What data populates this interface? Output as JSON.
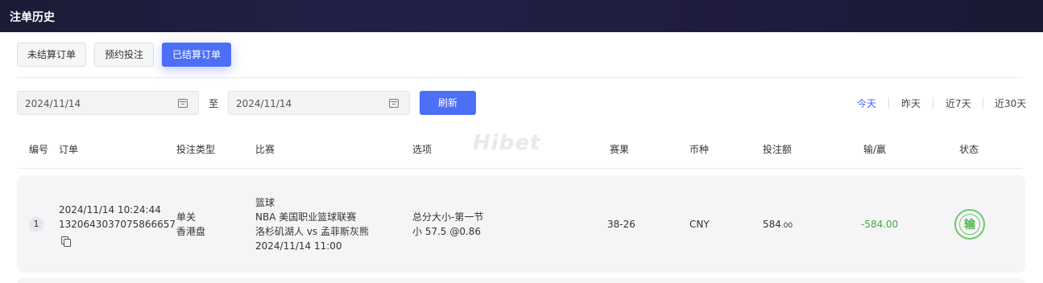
{
  "header": {
    "title": "注单历史"
  },
  "tabs": [
    {
      "label": "未结算订单",
      "active": false
    },
    {
      "label": "预约投注",
      "active": false
    },
    {
      "label": "已结算订单",
      "active": true
    }
  ],
  "filter": {
    "start_date": "2024/11/14",
    "to_label": "至",
    "end_date": "2024/11/14",
    "refresh_label": "刷新",
    "quick_ranges": [
      "今天",
      "昨天",
      "近7天",
      "近30天"
    ],
    "active_range": "今天"
  },
  "watermark": "Hibet",
  "table": {
    "columns": [
      "编号",
      "订单",
      "投注类型",
      "比赛",
      "选项",
      "赛果",
      "币种",
      "投注额",
      "输/赢",
      "状态"
    ],
    "rows": [
      {
        "index": "1",
        "order_time": "2024/11/14 10:24:44",
        "order_id": "1320643037075866657",
        "bet_type": "单关",
        "odds_type": "香港盘",
        "sport": "篮球",
        "league": "NBA 美国职业篮球联赛",
        "match": "洛杉矶湖人 vs 孟菲斯灰熊",
        "match_time": "2024/11/14 11:00",
        "market": "总分大小-第一节",
        "selection": "小 57.5 @0.86",
        "result": "38-26",
        "currency": "CNY",
        "stake_int": "584",
        "stake_dec": ".00",
        "win_loss": "-584.00",
        "status": "输"
      }
    ]
  },
  "colors": {
    "accent": "#4d6ef6",
    "loss": "#3dab3d",
    "header_bg": "#1c1b36"
  }
}
